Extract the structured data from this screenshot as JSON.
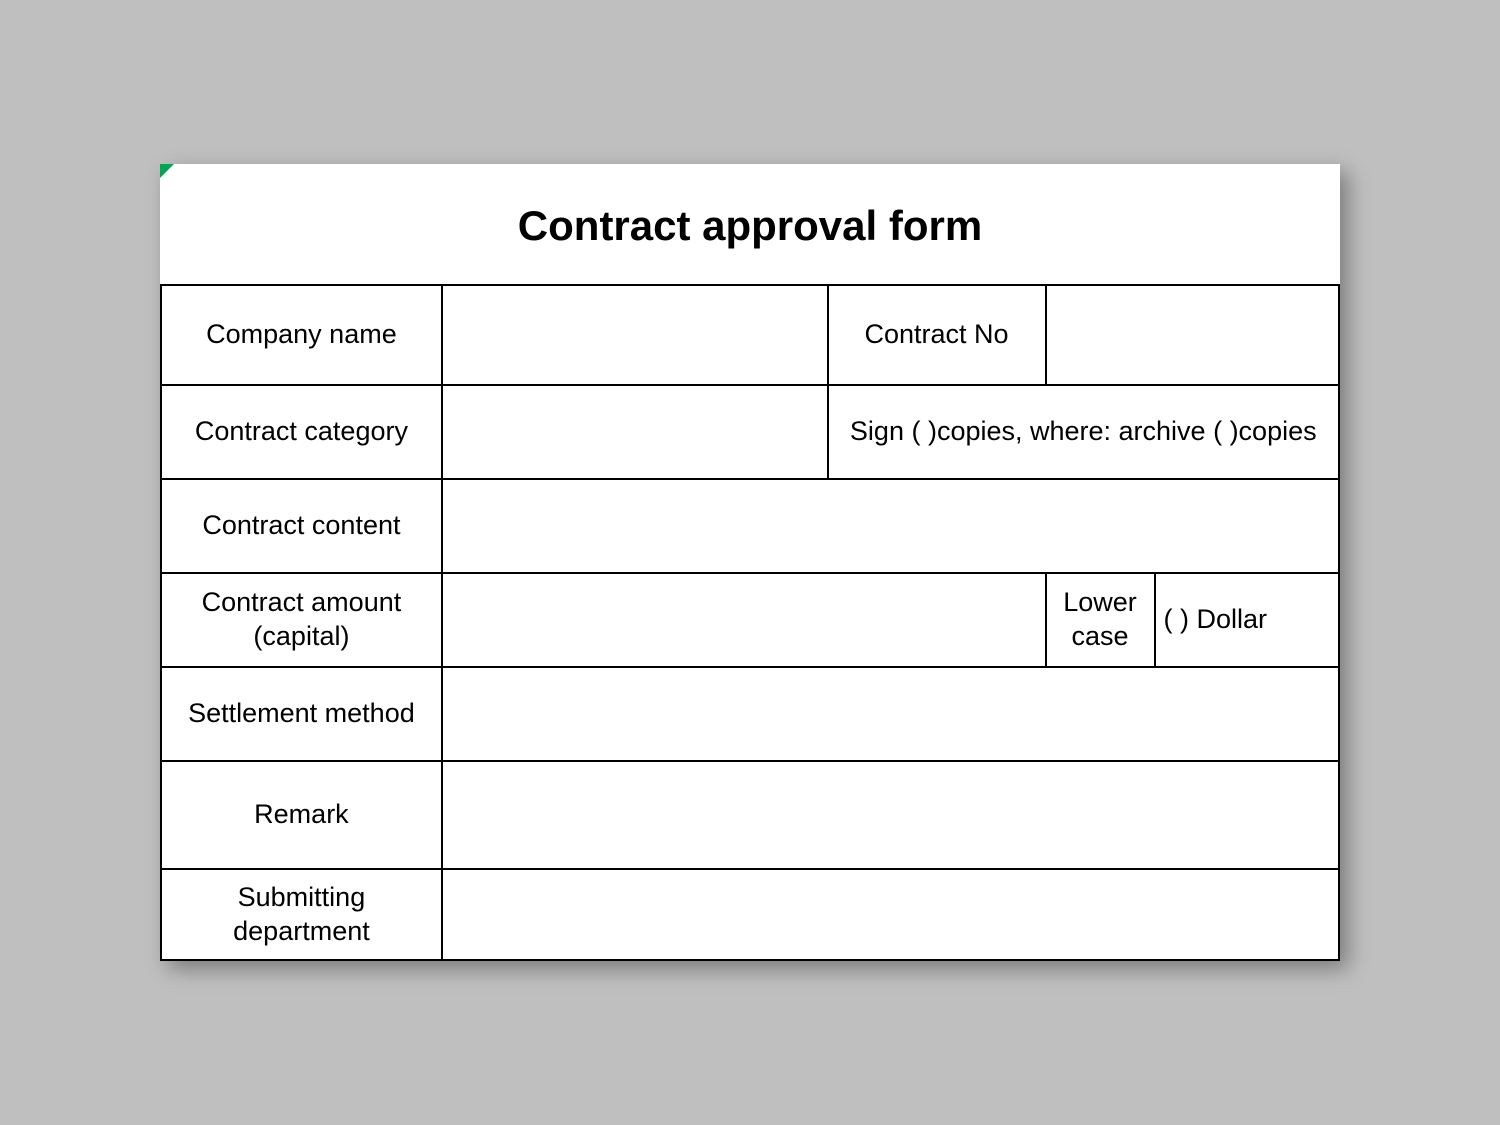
{
  "title": "Contract approval form",
  "rows": {
    "company_name_label": "Company name",
    "company_name_value": "",
    "contract_no_label": "Contract No",
    "contract_no_value": "",
    "contract_category_label": "Contract category",
    "contract_category_value": "",
    "copies_text": "Sign ( )copies, where: archive ( )copies",
    "contract_content_label": "Contract content",
    "contract_content_value": "",
    "contract_amount_label": "Contract amount (capital)",
    "contract_amount_value": "",
    "lower_case_label": "Lower case",
    "dollar_text": "(        ) Dollar",
    "settlement_method_label": "Settlement method",
    "settlement_method_value": "",
    "remark_label": "Remark",
    "remark_value": "",
    "submitting_dept_label": "Submitting department",
    "submitting_dept_value": ""
  }
}
